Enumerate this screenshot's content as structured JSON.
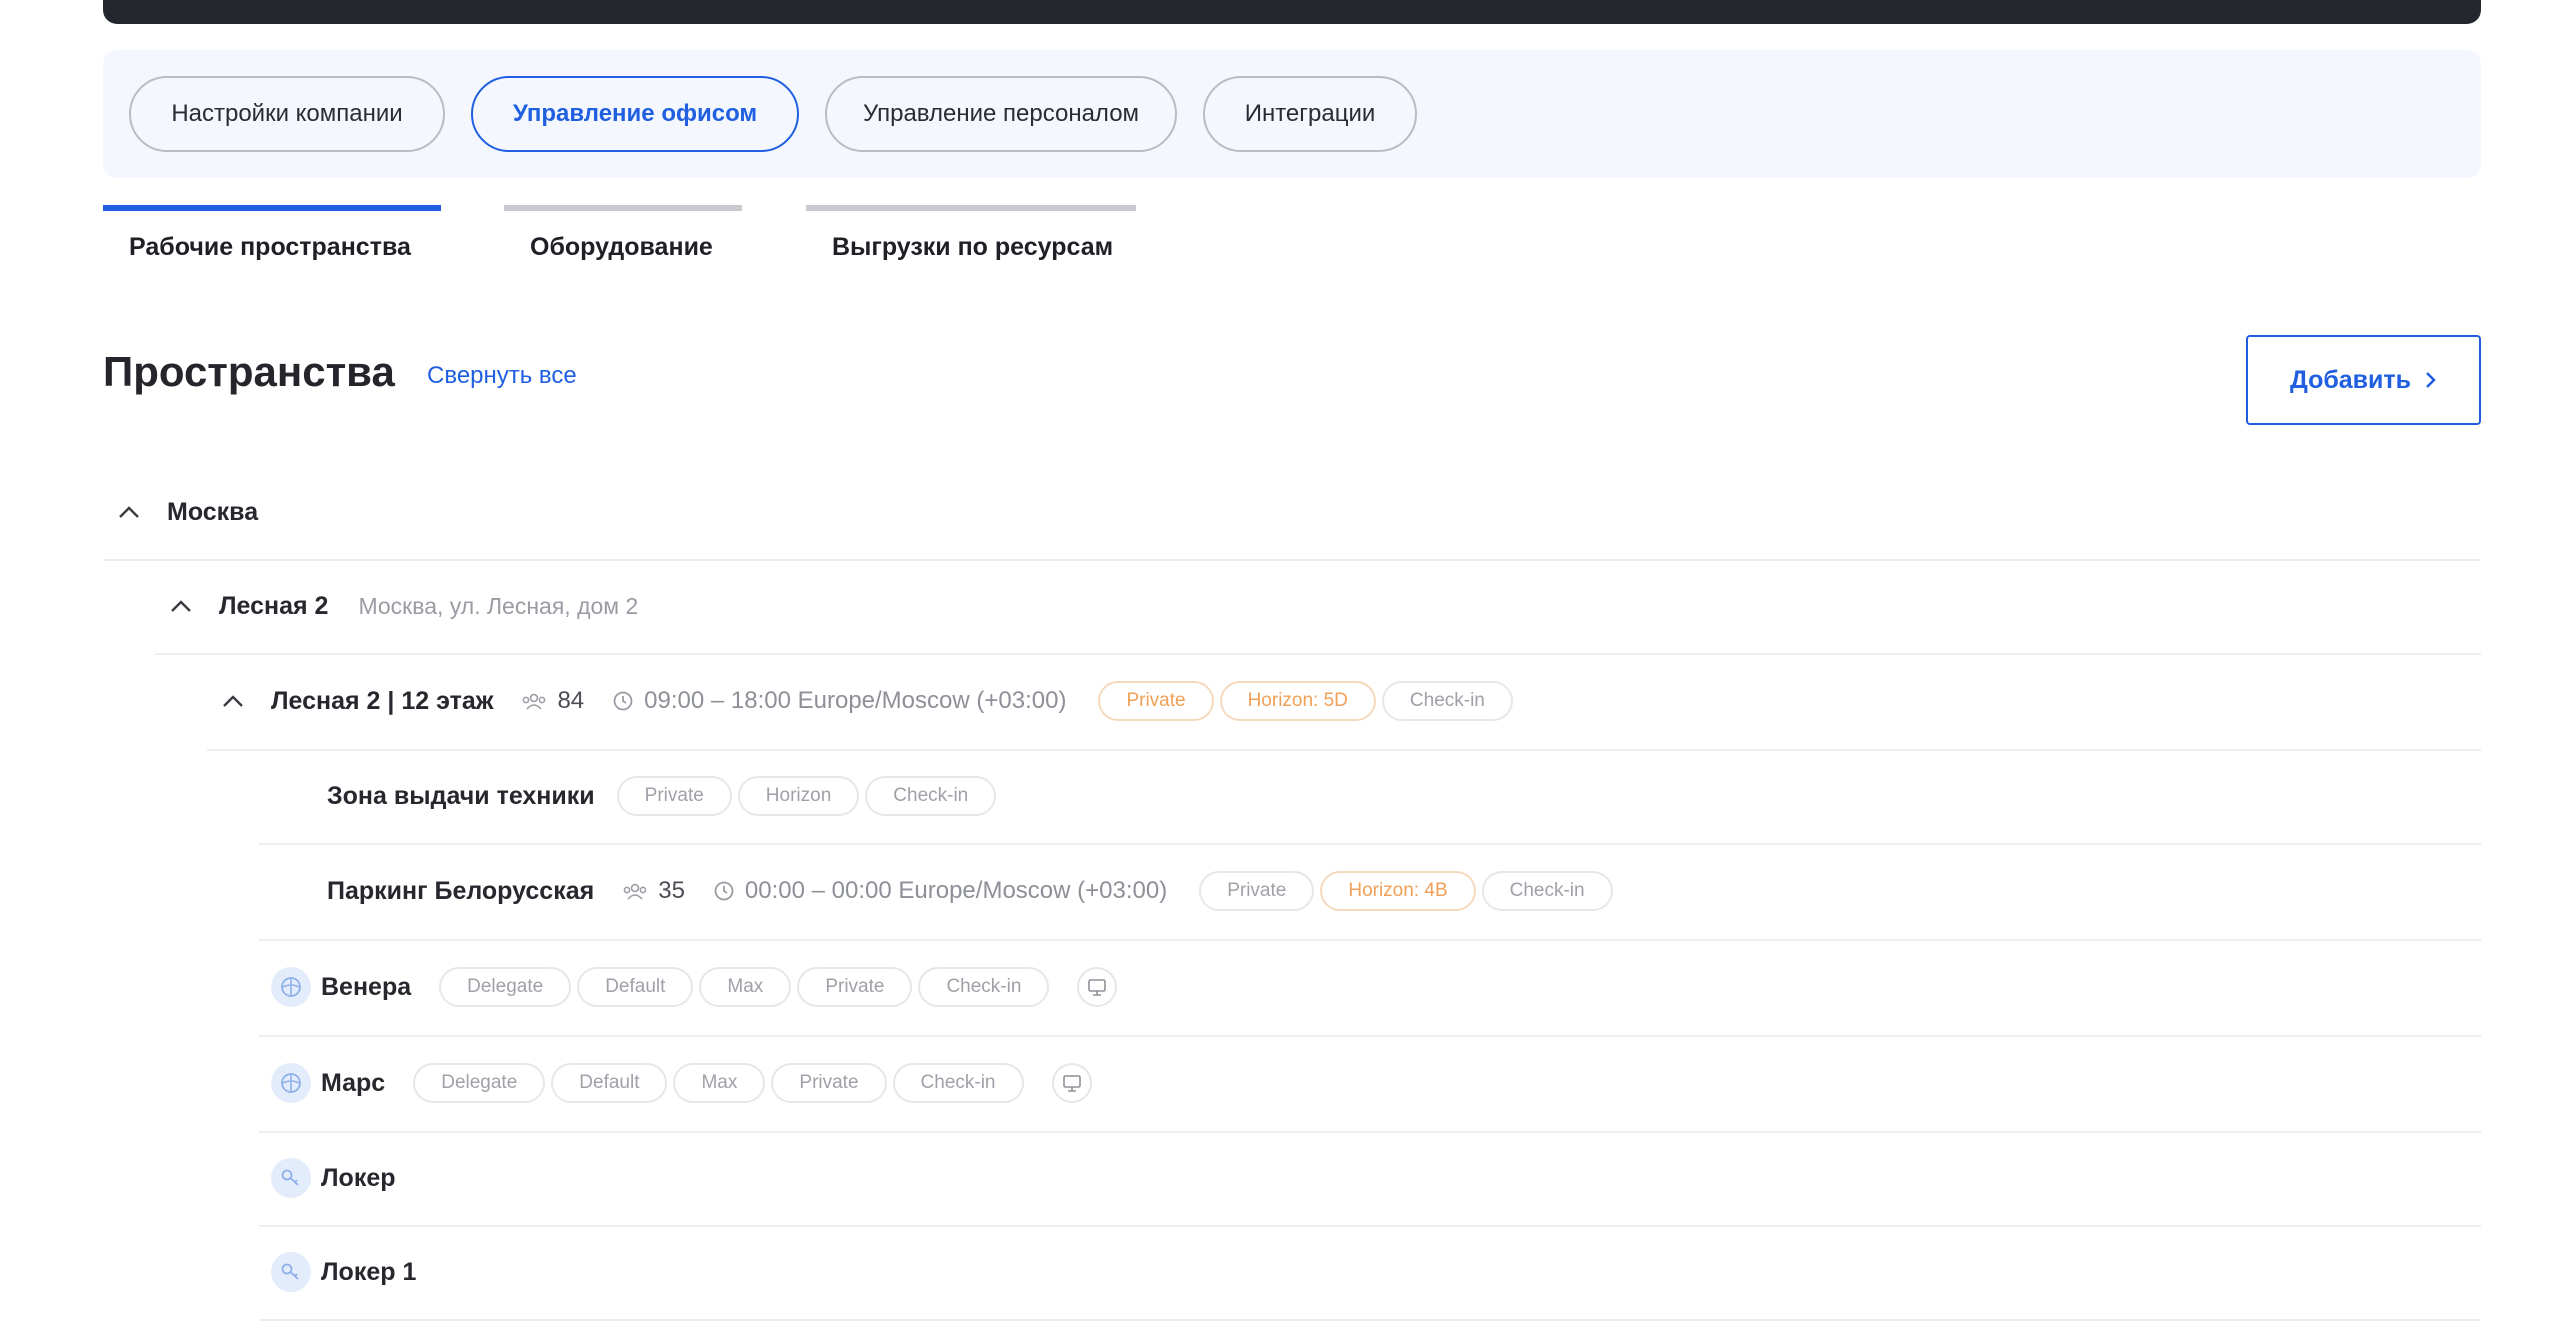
{
  "modules": [
    {
      "label": "Настройки компании",
      "active": false
    },
    {
      "label": "Управление офисом",
      "active": true
    },
    {
      "label": "Управление персоналом",
      "active": false
    },
    {
      "label": "Интеграции",
      "active": false
    }
  ],
  "subtabs": [
    {
      "label": "Рабочие пространства",
      "active": true
    },
    {
      "label": "Оборудование",
      "active": false
    },
    {
      "label": "Выгрузки по ресурсам",
      "active": false
    }
  ],
  "page": {
    "title": "Пространства",
    "collapse_all": "Свернуть все",
    "add_label": "Добавить"
  },
  "tree": {
    "city": "Москва",
    "building": {
      "name": "Лесная 2",
      "address": "Москва, ул. Лесная, дом 2"
    },
    "floor": {
      "name": "Лесная 2 | 12 этаж",
      "capacity": "84",
      "hours": "09:00 – 18:00 Europe/Moscow (+03:00)",
      "tags": [
        "Private",
        "Horizon: 5D",
        "Check-in"
      ]
    },
    "zone1": {
      "name": "Зона выдачи техники",
      "tags": [
        "Private",
        "Horizon",
        "Check-in"
      ]
    },
    "zone2": {
      "name": "Паркинг Белорусская",
      "capacity": "35",
      "hours": "00:00 – 00:00 Europe/Moscow (+03:00)",
      "tags": [
        "Private",
        "Horizon: 4B",
        "Check-in"
      ]
    },
    "room1": {
      "name": "Венера",
      "tags": [
        "Delegate",
        "Default",
        "Max",
        "Private",
        "Check-in"
      ]
    },
    "room2": {
      "name": "Марс",
      "tags": [
        "Delegate",
        "Default",
        "Max",
        "Private",
        "Check-in"
      ]
    },
    "locker1": {
      "name": "Локер"
    },
    "locker2": {
      "name": "Локер 1"
    }
  },
  "colors": {
    "accent": "#1f5fe0",
    "orange_tag": "#f0a057",
    "topbar": "#25272e"
  }
}
